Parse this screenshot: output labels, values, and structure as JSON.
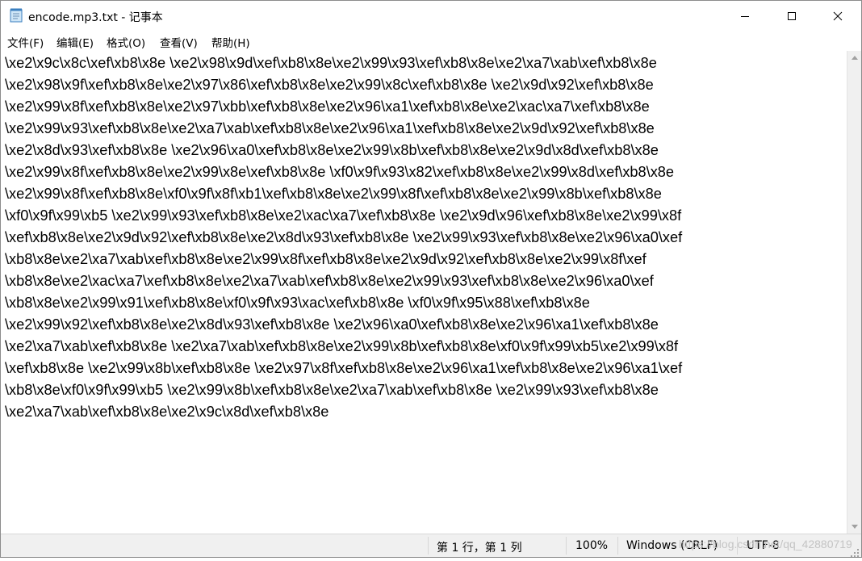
{
  "window": {
    "title": "encode.mp3.txt - 记事本",
    "icons": {
      "app": "notepad-icon",
      "minimize": "minimize-icon",
      "maximize": "maximize-icon",
      "close": "close-icon"
    }
  },
  "menu": {
    "items": [
      {
        "label": "文件(F)"
      },
      {
        "label": "编辑(E)"
      },
      {
        "label": "格式(O)"
      },
      {
        "label": "查看(V)"
      },
      {
        "label": "帮助(H)"
      }
    ]
  },
  "editor": {
    "content": "\\xe2\\x9c\\x8c\\xef\\xb8\\x8e \\xe2\\x98\\x9d\\xef\\xb8\\x8e\\xe2\\x99\\x93\\xef\\xb8\\x8e\\xe2\\xa7\\xab\\xef\\xb8\\x8e\n\\xe2\\x98\\x9f\\xef\\xb8\\x8e\\xe2\\x97\\x86\\xef\\xb8\\x8e\\xe2\\x99\\x8c\\xef\\xb8\\x8e \\xe2\\x9d\\x92\\xef\\xb8\\x8e\n\\xe2\\x99\\x8f\\xef\\xb8\\x8e\\xe2\\x97\\xbb\\xef\\xb8\\x8e\\xe2\\x96\\xa1\\xef\\xb8\\x8e\\xe2\\xac\\xa7\\xef\\xb8\\x8e\n\\xe2\\x99\\x93\\xef\\xb8\\x8e\\xe2\\xa7\\xab\\xef\\xb8\\x8e\\xe2\\x96\\xa1\\xef\\xb8\\x8e\\xe2\\x9d\\x92\\xef\\xb8\\x8e\n\\xe2\\x8d\\x93\\xef\\xb8\\x8e \\xe2\\x96\\xa0\\xef\\xb8\\x8e\\xe2\\x99\\x8b\\xef\\xb8\\x8e\\xe2\\x9d\\x8d\\xef\\xb8\\x8e\n\\xe2\\x99\\x8f\\xef\\xb8\\x8e\\xe2\\x99\\x8e\\xef\\xb8\\x8e \\xf0\\x9f\\x93\\x82\\xef\\xb8\\x8e\\xe2\\x99\\x8d\\xef\\xb8\\x8e\n\\xe2\\x99\\x8f\\xef\\xb8\\x8e\\xf0\\x9f\\x8f\\xb1\\xef\\xb8\\x8e\\xe2\\x99\\x8f\\xef\\xb8\\x8e\\xe2\\x99\\x8b\\xef\\xb8\\x8e\n\\xf0\\x9f\\x99\\xb5 \\xe2\\x99\\x93\\xef\\xb8\\x8e\\xe2\\xac\\xa7\\xef\\xb8\\x8e \\xe2\\x9d\\x96\\xef\\xb8\\x8e\\xe2\\x99\\x8f\n\\xef\\xb8\\x8e\\xe2\\x9d\\x92\\xef\\xb8\\x8e\\xe2\\x8d\\x93\\xef\\xb8\\x8e \\xe2\\x99\\x93\\xef\\xb8\\x8e\\xe2\\x96\\xa0\\xef\n\\xb8\\x8e\\xe2\\xa7\\xab\\xef\\xb8\\x8e\\xe2\\x99\\x8f\\xef\\xb8\\x8e\\xe2\\x9d\\x92\\xef\\xb8\\x8e\\xe2\\x99\\x8f\\xef\n\\xb8\\x8e\\xe2\\xac\\xa7\\xef\\xb8\\x8e\\xe2\\xa7\\xab\\xef\\xb8\\x8e\\xe2\\x99\\x93\\xef\\xb8\\x8e\\xe2\\x96\\xa0\\xef\n\\xb8\\x8e\\xe2\\x99\\x91\\xef\\xb8\\x8e\\xf0\\x9f\\x93\\xac\\xef\\xb8\\x8e \\xf0\\x9f\\x95\\x88\\xef\\xb8\\x8e\n\\xe2\\x99\\x92\\xef\\xb8\\x8e\\xe2\\x8d\\x93\\xef\\xb8\\x8e \\xe2\\x96\\xa0\\xef\\xb8\\x8e\\xe2\\x96\\xa1\\xef\\xb8\\x8e\n\\xe2\\xa7\\xab\\xef\\xb8\\x8e \\xe2\\xa7\\xab\\xef\\xb8\\x8e\\xe2\\x99\\x8b\\xef\\xb8\\x8e\\xf0\\x9f\\x99\\xb5\\xe2\\x99\\x8f\n\\xef\\xb8\\x8e \\xe2\\x99\\x8b\\xef\\xb8\\x8e \\xe2\\x97\\x8f\\xef\\xb8\\x8e\\xe2\\x96\\xa1\\xef\\xb8\\x8e\\xe2\\x96\\xa1\\xef\n\\xb8\\x8e\\xf0\\x9f\\x99\\xb5 \\xe2\\x99\\x8b\\xef\\xb8\\x8e\\xe2\\xa7\\xab\\xef\\xb8\\x8e \\xe2\\x99\\x93\\xef\\xb8\\x8e\n\\xe2\\xa7\\xab\\xef\\xb8\\x8e\\xe2\\x9c\\x8d\\xef\\xb8\\x8e"
  },
  "status": {
    "position": "第 1 行，第 1 列",
    "zoom": "100%",
    "line_ending": "Windows (CRLF)",
    "encoding": "UTF-8",
    "watermark": "https://blog.csdn.net/qq_42880719"
  }
}
